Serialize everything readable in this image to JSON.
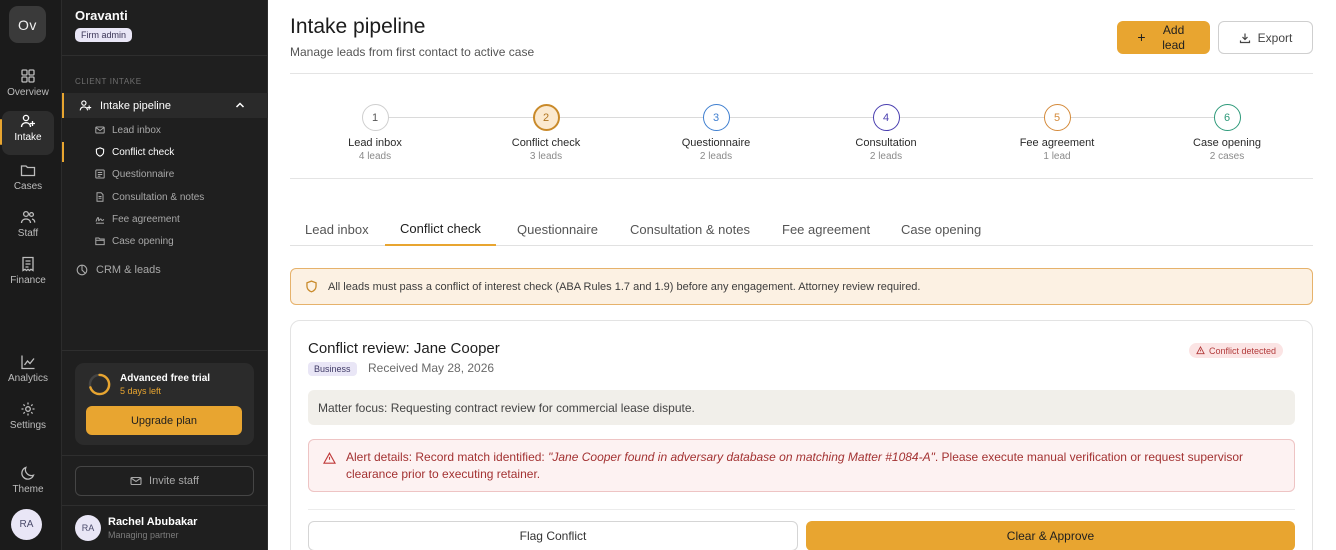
{
  "rail": {
    "logo": "Ov",
    "items": [
      {
        "label": "Overview",
        "icon": "grid-icon"
      },
      {
        "label": "Intake",
        "icon": "user-plus-icon"
      },
      {
        "label": "Cases",
        "icon": "folder-icon"
      },
      {
        "label": "Staff",
        "icon": "users-icon"
      },
      {
        "label": "Finance",
        "icon": "receipt-icon"
      },
      {
        "label": "Analytics",
        "icon": "chart-icon"
      },
      {
        "label": "Settings",
        "icon": "gear-icon"
      },
      {
        "label": "Theme",
        "icon": "moon-icon"
      }
    ],
    "avatar": "RA"
  },
  "sidebar": {
    "org_name": "Oravanti",
    "org_role": "Firm admin",
    "section_label": "CLIENT INTAKE",
    "parent": "Intake pipeline",
    "sub_items": [
      {
        "label": "Lead inbox"
      },
      {
        "label": "Conflict check"
      },
      {
        "label": "Questionnaire"
      },
      {
        "label": "Consultation & notes"
      },
      {
        "label": "Fee agreement"
      },
      {
        "label": "Case opening"
      }
    ],
    "crm": "CRM & leads",
    "trial": {
      "title": "Advanced free trial",
      "days": "5 days left",
      "button": "Upgrade plan"
    },
    "invite": "Invite staff",
    "user": {
      "initials": "RA",
      "name": "Rachel Abubakar",
      "role": "Managing partner"
    }
  },
  "header": {
    "title": "Intake pipeline",
    "subtitle": "Manage leads from first contact to active case",
    "add_label": "Add lead",
    "export_label": "Export"
  },
  "steps": [
    {
      "num": "1",
      "label": "Lead inbox",
      "count": "4 leads",
      "color": "#9a9a9a"
    },
    {
      "num": "2",
      "label": "Conflict check",
      "count": "3 leads",
      "color": "#c98a2a"
    },
    {
      "num": "3",
      "label": "Questionnaire",
      "count": "2 leads",
      "color": "#3f7fd0"
    },
    {
      "num": "4",
      "label": "Consultation",
      "count": "2 leads",
      "color": "#4a3fb0"
    },
    {
      "num": "5",
      "label": "Fee agreement",
      "count": "1 lead",
      "color": "#d48a3a"
    },
    {
      "num": "6",
      "label": "Case opening",
      "count": "2 cases",
      "color": "#2e9a7a"
    }
  ],
  "tabs": [
    "Lead inbox",
    "Conflict check",
    "Questionnaire",
    "Consultation & notes",
    "Fee agreement",
    "Case opening"
  ],
  "notice": "All leads must pass a conflict of interest check (ABA Rules 1.7 and 1.9) before any engagement. Attorney review required.",
  "card": {
    "title": "Conflict review: Jane Cooper",
    "tag": "Business",
    "received": "Received May 28, 2026",
    "badge": "Conflict detected",
    "matter": "Matter focus: Requesting contract review for commercial lease dispute.",
    "alert_prefix": "Alert details: Record match identified: ",
    "alert_quote": "\"Jane Cooper found in adversary database on matching Matter #1084-A\"",
    "alert_suffix": ". Please execute manual verification or request supervisor clearance prior to executing retainer.",
    "flag_label": "Flag Conflict",
    "approve_label": "Clear & Approve"
  },
  "colors": {
    "accent": "#e8a530",
    "danger": "#b23b3b"
  }
}
